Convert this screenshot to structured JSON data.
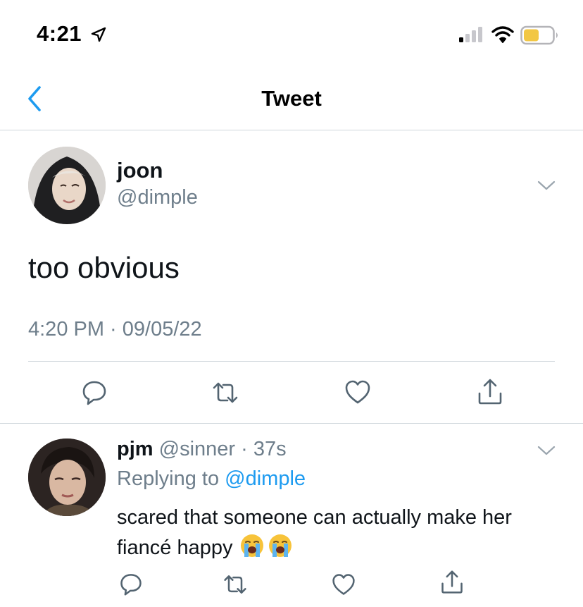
{
  "status_bar": {
    "time": "4:21",
    "icons": [
      "location-arrow-icon",
      "cellular-signal-icon",
      "wifi-icon",
      "battery-icon"
    ],
    "battery_color": "#f2c744"
  },
  "nav": {
    "back_icon": "chevron-left-icon",
    "title": "Tweet"
  },
  "tweet": {
    "display_name": "joon",
    "handle": "@dimple",
    "text": "too obvious",
    "timestamp": "4:20 PM · 09/05/22",
    "actions": [
      "reply-icon",
      "retweet-icon",
      "like-icon",
      "share-icon"
    ]
  },
  "reply": {
    "display_name": "pjm",
    "handle": "@sinner",
    "time": " · 37s",
    "replying_prefix": "Replying to ",
    "replying_to": "@dimple",
    "text": "scared that someone can actually make her fiancé happy",
    "emojis": [
      "loudly-crying-face-emoji",
      "loudly-crying-face-emoji"
    ],
    "actions": [
      "reply-icon",
      "retweet-icon",
      "like-icon",
      "share-icon"
    ]
  },
  "colors": {
    "accent": "#1d9bf0",
    "secondary_text": "#6e7e8b",
    "divider": "#cfd6dc"
  }
}
